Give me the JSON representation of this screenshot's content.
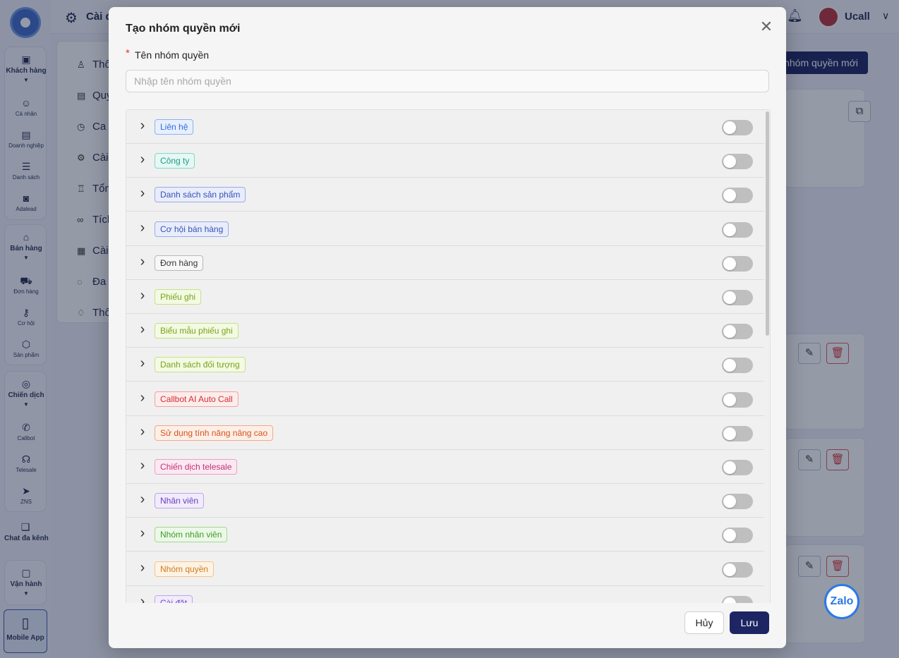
{
  "sidebar": {
    "groups": [
      {
        "head": "Khách hàng",
        "items": [
          "Cá nhân",
          "Doanh nghiệp",
          "Danh sách",
          "Adalead"
        ]
      },
      {
        "head": "Bán hàng",
        "items": [
          "Đơn hàng",
          "Cơ hội",
          "Sản phẩm"
        ]
      },
      {
        "head": "Chiến dịch",
        "items": [
          "Callbot",
          "Telesale",
          "ZNS"
        ]
      }
    ],
    "chat": "Chat đa kênh",
    "ops": "Vận hành",
    "mobile": "Mobile App"
  },
  "topbar": {
    "title": "Cài đ",
    "user": "Ucall"
  },
  "settings_menu": [
    "Thô",
    "Quy",
    "Ca",
    "Cài",
    "Tổn",
    "Tích",
    "Cài",
    "Đa",
    "Thô"
  ],
  "page": {
    "new_group_button": "nhóm quyền mới"
  },
  "zalo": "Zalo",
  "modal": {
    "title": "Tạo nhóm quyền mới",
    "field_label": "Tên nhóm quyền",
    "field_placeholder": "Nhập tên nhóm quyền",
    "field_value": "",
    "cancel_label": "Hủy",
    "save_label": "Lưu",
    "permissions": [
      {
        "label": "Liên hệ",
        "color": "#2f6fd6",
        "bg": "#e7efff",
        "border": "#8fb1ee",
        "enabled": false
      },
      {
        "label": "Công ty",
        "color": "#1f9b8b",
        "bg": "#e5f8f4",
        "border": "#86d6c9",
        "enabled": false
      },
      {
        "label": "Danh sách sản phẩm",
        "color": "#3552b7",
        "bg": "#e9edfb",
        "border": "#9aaae6",
        "enabled": false
      },
      {
        "label": "Cơ hội bán hàng",
        "color": "#3552b7",
        "bg": "#e9edfb",
        "border": "#9aaae6",
        "enabled": false
      },
      {
        "label": "Đơn hàng",
        "color": "#333333",
        "bg": "#f7f7f7",
        "border": "#b8b8b8",
        "enabled": false
      },
      {
        "label": "Phiếu ghi",
        "color": "#7aa21b",
        "bg": "#f3fae3",
        "border": "#c6e08a",
        "enabled": false
      },
      {
        "label": "Biểu mẫu phiếu ghi",
        "color": "#7aa21b",
        "bg": "#f3fae3",
        "border": "#c6e08a",
        "enabled": false
      },
      {
        "label": "Danh sách đối tượng",
        "color": "#7aa21b",
        "bg": "#f3fae3",
        "border": "#c6e08a",
        "enabled": false
      },
      {
        "label": "Callbot AI Auto Call",
        "color": "#d32f2f",
        "bg": "#fdecec",
        "border": "#f0a2a2",
        "enabled": false
      },
      {
        "label": "Sử dụng tính năng nâng cao",
        "color": "#d4541d",
        "bg": "#fdefe7",
        "border": "#f2a987",
        "enabled": false
      },
      {
        "label": "Chiến dịch telesale",
        "color": "#c2307b",
        "bg": "#fbe9f2",
        "border": "#eaa0c6",
        "enabled": false
      },
      {
        "label": "Nhân viên",
        "color": "#6a3fc1",
        "bg": "#f1ebfb",
        "border": "#bfa6ea",
        "enabled": false
      },
      {
        "label": "Nhóm nhân viên",
        "color": "#3e9b2a",
        "bg": "#ecf8e7",
        "border": "#a2d895",
        "enabled": false
      },
      {
        "label": "Nhóm quyền",
        "color": "#cf7a1a",
        "bg": "#fdf3e5",
        "border": "#f0c48e",
        "enabled": false
      },
      {
        "label": "Cài đặt",
        "color": "#6a3fc1",
        "bg": "#f1ebfb",
        "border": "#bfa6ea",
        "enabled": false
      }
    ]
  }
}
